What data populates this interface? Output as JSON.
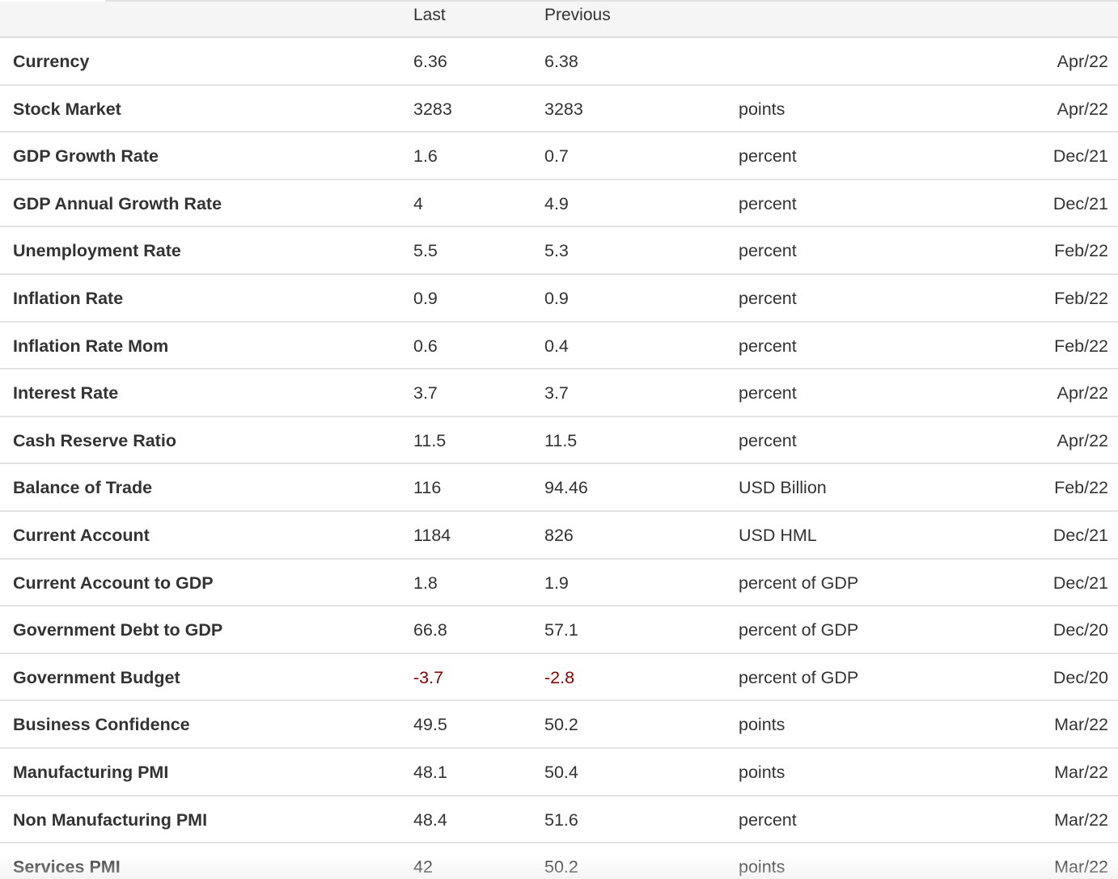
{
  "table": {
    "columns": {
      "name": "",
      "last": "Last",
      "previous": "Previous",
      "unit": "",
      "date": ""
    },
    "rows": [
      {
        "name": "Currency",
        "last": "6.36",
        "previous": "6.38",
        "unit": "",
        "date": "Apr/22"
      },
      {
        "name": "Stock Market",
        "last": "3283",
        "previous": "3283",
        "unit": "points",
        "date": "Apr/22"
      },
      {
        "name": "GDP Growth Rate",
        "last": "1.6",
        "previous": "0.7",
        "unit": "percent",
        "date": "Dec/21"
      },
      {
        "name": "GDP Annual Growth Rate",
        "last": "4",
        "previous": "4.9",
        "unit": "percent",
        "date": "Dec/21"
      },
      {
        "name": "Unemployment Rate",
        "last": "5.5",
        "previous": "5.3",
        "unit": "percent",
        "date": "Feb/22"
      },
      {
        "name": "Inflation Rate",
        "last": "0.9",
        "previous": "0.9",
        "unit": "percent",
        "date": "Feb/22"
      },
      {
        "name": "Inflation Rate Mom",
        "last": "0.6",
        "previous": "0.4",
        "unit": "percent",
        "date": "Feb/22"
      },
      {
        "name": "Interest Rate",
        "last": "3.7",
        "previous": "3.7",
        "unit": "percent",
        "date": "Apr/22"
      },
      {
        "name": "Cash Reserve Ratio",
        "last": "11.5",
        "previous": "11.5",
        "unit": "percent",
        "date": "Apr/22"
      },
      {
        "name": "Balance of Trade",
        "last": "116",
        "previous": "94.46",
        "unit": "USD Billion",
        "date": "Feb/22"
      },
      {
        "name": "Current Account",
        "last": "1184",
        "previous": "826",
        "unit": "USD HML",
        "date": "Dec/21"
      },
      {
        "name": "Current Account to GDP",
        "last": "1.8",
        "previous": "1.9",
        "unit": "percent of GDP",
        "date": "Dec/21"
      },
      {
        "name": "Government Debt to GDP",
        "last": "66.8",
        "previous": "57.1",
        "unit": "percent of GDP",
        "date": "Dec/20"
      },
      {
        "name": "Government Budget",
        "last": "-3.7",
        "previous": "-2.8",
        "unit": "percent of GDP",
        "date": "Dec/20"
      },
      {
        "name": "Business Confidence",
        "last": "49.5",
        "previous": "50.2",
        "unit": "points",
        "date": "Mar/22"
      },
      {
        "name": "Manufacturing PMI",
        "last": "48.1",
        "previous": "50.4",
        "unit": "points",
        "date": "Mar/22"
      },
      {
        "name": "Non Manufacturing PMI",
        "last": "48.4",
        "previous": "51.6",
        "unit": "percent",
        "date": "Mar/22"
      },
      {
        "name": "Services PMI",
        "last": "42",
        "previous": "50.2",
        "unit": "points",
        "date": "Mar/22"
      }
    ]
  },
  "colors": {
    "text": "#333333",
    "negative": "#8b0000",
    "header_bg": "#f5f5f5",
    "divider": "#e3e3e3"
  }
}
